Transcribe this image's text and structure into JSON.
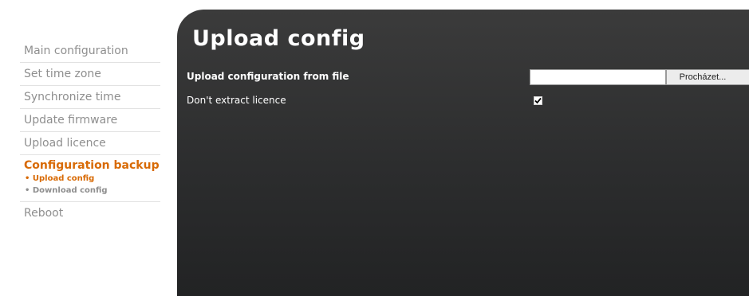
{
  "sidebar": {
    "items": [
      {
        "label": "Main configuration"
      },
      {
        "label": "Set time zone"
      },
      {
        "label": "Synchronize time"
      },
      {
        "label": "Update firmware"
      },
      {
        "label": "Upload licence"
      }
    ],
    "active_group": {
      "label": "Configuration backup",
      "sub_items": [
        {
          "label": "• Upload config",
          "active": true
        },
        {
          "label": "• Download config",
          "active": false
        }
      ]
    },
    "last_item": {
      "label": "Reboot"
    }
  },
  "main": {
    "title": "Upload config",
    "upload_row": {
      "label": "Upload configuration from file",
      "file_value": "",
      "browse_label": "Procházet..."
    },
    "licence_row": {
      "label": "Don't extract licence",
      "checked": true,
      "check_glyph": "✔"
    }
  },
  "colors": {
    "accent": "#d86a05",
    "nav_text": "#8f8f8f",
    "panel_bg": "#2c2d2e"
  }
}
